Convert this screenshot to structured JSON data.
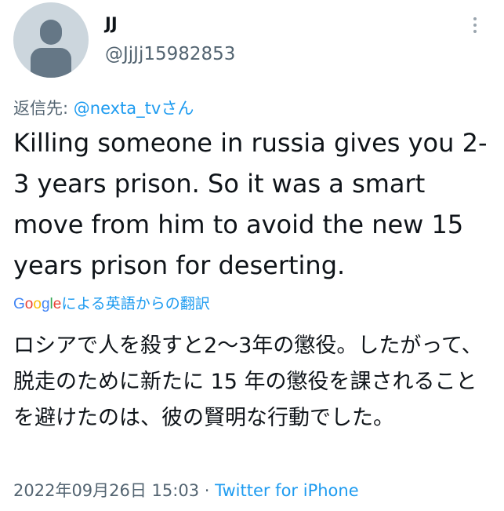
{
  "user": {
    "display_name": "JJ",
    "handle": "@JjJj15982853"
  },
  "reply": {
    "prefix": "返信先: ",
    "mention": "@nexta_tvさん"
  },
  "tweet": {
    "text": "Killing someone in russia gives you 2-3 years prison. So it was a smart move from him to avoid the new 15 years prison for deserting."
  },
  "translation": {
    "google_logo": "Google",
    "by_label": "による英語からの翻訳",
    "text": "ロシアで人を殺すと2〜3年の懲役。したがって、脱走のために新たに 15 年の懲役を課されることを避けたのは、彼の賢明な行動でした。"
  },
  "meta": {
    "timestamp": "2022年09月26日 15:03",
    "separator": " · ",
    "source": "Twitter for iPhone"
  },
  "icons": {
    "avatar": "default-avatar-icon",
    "more": "more-vertical-icon"
  },
  "colors": {
    "link": "#1d9bf0",
    "secondary_text": "#536471",
    "primary_text": "#0f1419",
    "google_blue": "#4285f4",
    "google_red": "#ea4335",
    "google_yellow": "#fbbc05",
    "google_green": "#34a853"
  }
}
